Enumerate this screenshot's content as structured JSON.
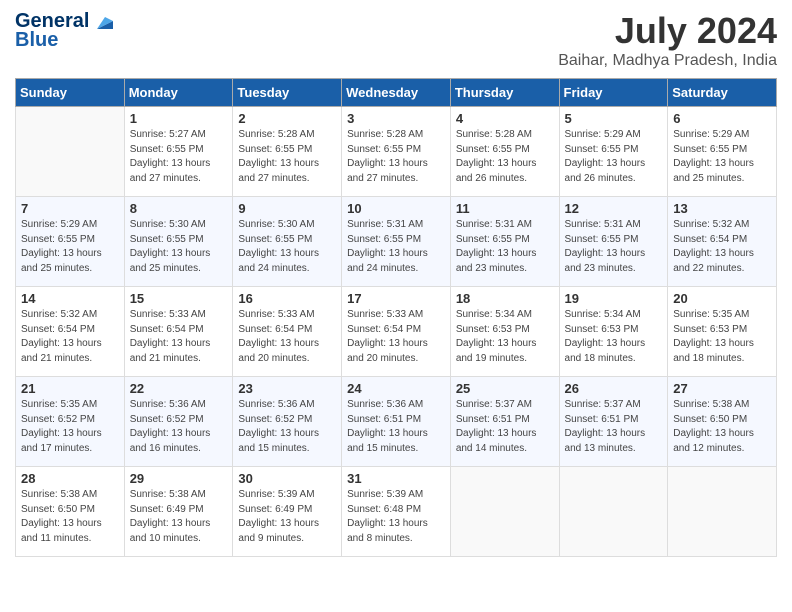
{
  "header": {
    "logo_general": "General",
    "logo_blue": "Blue",
    "month_year": "July 2024",
    "location": "Baihar, Madhya Pradesh, India"
  },
  "weekdays": [
    "Sunday",
    "Monday",
    "Tuesday",
    "Wednesday",
    "Thursday",
    "Friday",
    "Saturday"
  ],
  "weeks": [
    [
      {
        "day": "",
        "sunrise": "",
        "sunset": "",
        "daylight": ""
      },
      {
        "day": "1",
        "sunrise": "Sunrise: 5:27 AM",
        "sunset": "Sunset: 6:55 PM",
        "daylight": "Daylight: 13 hours and 27 minutes."
      },
      {
        "day": "2",
        "sunrise": "Sunrise: 5:28 AM",
        "sunset": "Sunset: 6:55 PM",
        "daylight": "Daylight: 13 hours and 27 minutes."
      },
      {
        "day": "3",
        "sunrise": "Sunrise: 5:28 AM",
        "sunset": "Sunset: 6:55 PM",
        "daylight": "Daylight: 13 hours and 27 minutes."
      },
      {
        "day": "4",
        "sunrise": "Sunrise: 5:28 AM",
        "sunset": "Sunset: 6:55 PM",
        "daylight": "Daylight: 13 hours and 26 minutes."
      },
      {
        "day": "5",
        "sunrise": "Sunrise: 5:29 AM",
        "sunset": "Sunset: 6:55 PM",
        "daylight": "Daylight: 13 hours and 26 minutes."
      },
      {
        "day": "6",
        "sunrise": "Sunrise: 5:29 AM",
        "sunset": "Sunset: 6:55 PM",
        "daylight": "Daylight: 13 hours and 25 minutes."
      }
    ],
    [
      {
        "day": "7",
        "sunrise": "Sunrise: 5:29 AM",
        "sunset": "Sunset: 6:55 PM",
        "daylight": "Daylight: 13 hours and 25 minutes."
      },
      {
        "day": "8",
        "sunrise": "Sunrise: 5:30 AM",
        "sunset": "Sunset: 6:55 PM",
        "daylight": "Daylight: 13 hours and 25 minutes."
      },
      {
        "day": "9",
        "sunrise": "Sunrise: 5:30 AM",
        "sunset": "Sunset: 6:55 PM",
        "daylight": "Daylight: 13 hours and 24 minutes."
      },
      {
        "day": "10",
        "sunrise": "Sunrise: 5:31 AM",
        "sunset": "Sunset: 6:55 PM",
        "daylight": "Daylight: 13 hours and 24 minutes."
      },
      {
        "day": "11",
        "sunrise": "Sunrise: 5:31 AM",
        "sunset": "Sunset: 6:55 PM",
        "daylight": "Daylight: 13 hours and 23 minutes."
      },
      {
        "day": "12",
        "sunrise": "Sunrise: 5:31 AM",
        "sunset": "Sunset: 6:55 PM",
        "daylight": "Daylight: 13 hours and 23 minutes."
      },
      {
        "day": "13",
        "sunrise": "Sunrise: 5:32 AM",
        "sunset": "Sunset: 6:54 PM",
        "daylight": "Daylight: 13 hours and 22 minutes."
      }
    ],
    [
      {
        "day": "14",
        "sunrise": "Sunrise: 5:32 AM",
        "sunset": "Sunset: 6:54 PM",
        "daylight": "Daylight: 13 hours and 21 minutes."
      },
      {
        "day": "15",
        "sunrise": "Sunrise: 5:33 AM",
        "sunset": "Sunset: 6:54 PM",
        "daylight": "Daylight: 13 hours and 21 minutes."
      },
      {
        "day": "16",
        "sunrise": "Sunrise: 5:33 AM",
        "sunset": "Sunset: 6:54 PM",
        "daylight": "Daylight: 13 hours and 20 minutes."
      },
      {
        "day": "17",
        "sunrise": "Sunrise: 5:33 AM",
        "sunset": "Sunset: 6:54 PM",
        "daylight": "Daylight: 13 hours and 20 minutes."
      },
      {
        "day": "18",
        "sunrise": "Sunrise: 5:34 AM",
        "sunset": "Sunset: 6:53 PM",
        "daylight": "Daylight: 13 hours and 19 minutes."
      },
      {
        "day": "19",
        "sunrise": "Sunrise: 5:34 AM",
        "sunset": "Sunset: 6:53 PM",
        "daylight": "Daylight: 13 hours and 18 minutes."
      },
      {
        "day": "20",
        "sunrise": "Sunrise: 5:35 AM",
        "sunset": "Sunset: 6:53 PM",
        "daylight": "Daylight: 13 hours and 18 minutes."
      }
    ],
    [
      {
        "day": "21",
        "sunrise": "Sunrise: 5:35 AM",
        "sunset": "Sunset: 6:52 PM",
        "daylight": "Daylight: 13 hours and 17 minutes."
      },
      {
        "day": "22",
        "sunrise": "Sunrise: 5:36 AM",
        "sunset": "Sunset: 6:52 PM",
        "daylight": "Daylight: 13 hours and 16 minutes."
      },
      {
        "day": "23",
        "sunrise": "Sunrise: 5:36 AM",
        "sunset": "Sunset: 6:52 PM",
        "daylight": "Daylight: 13 hours and 15 minutes."
      },
      {
        "day": "24",
        "sunrise": "Sunrise: 5:36 AM",
        "sunset": "Sunset: 6:51 PM",
        "daylight": "Daylight: 13 hours and 15 minutes."
      },
      {
        "day": "25",
        "sunrise": "Sunrise: 5:37 AM",
        "sunset": "Sunset: 6:51 PM",
        "daylight": "Daylight: 13 hours and 14 minutes."
      },
      {
        "day": "26",
        "sunrise": "Sunrise: 5:37 AM",
        "sunset": "Sunset: 6:51 PM",
        "daylight": "Daylight: 13 hours and 13 minutes."
      },
      {
        "day": "27",
        "sunrise": "Sunrise: 5:38 AM",
        "sunset": "Sunset: 6:50 PM",
        "daylight": "Daylight: 13 hours and 12 minutes."
      }
    ],
    [
      {
        "day": "28",
        "sunrise": "Sunrise: 5:38 AM",
        "sunset": "Sunset: 6:50 PM",
        "daylight": "Daylight: 13 hours and 11 minutes."
      },
      {
        "day": "29",
        "sunrise": "Sunrise: 5:38 AM",
        "sunset": "Sunset: 6:49 PM",
        "daylight": "Daylight: 13 hours and 10 minutes."
      },
      {
        "day": "30",
        "sunrise": "Sunrise: 5:39 AM",
        "sunset": "Sunset: 6:49 PM",
        "daylight": "Daylight: 13 hours and 9 minutes."
      },
      {
        "day": "31",
        "sunrise": "Sunrise: 5:39 AM",
        "sunset": "Sunset: 6:48 PM",
        "daylight": "Daylight: 13 hours and 8 minutes."
      },
      {
        "day": "",
        "sunrise": "",
        "sunset": "",
        "daylight": ""
      },
      {
        "day": "",
        "sunrise": "",
        "sunset": "",
        "daylight": ""
      },
      {
        "day": "",
        "sunrise": "",
        "sunset": "",
        "daylight": ""
      }
    ]
  ]
}
